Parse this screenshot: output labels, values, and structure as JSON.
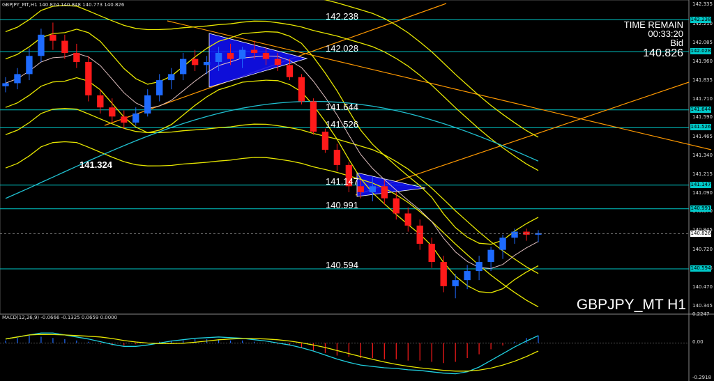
{
  "header": {
    "text": "GBPJPY_MT,H1  140.824 140.848 140.773 140.826"
  },
  "macd_header": {
    "text": "MACD(12,26,9) -0.0666 -0.1325 0.0659 0.0000"
  },
  "timer": {
    "label": "TIME REMAIN",
    "value": "00:33:20",
    "bid_label": "Bid",
    "bid_value": "140.826"
  },
  "symbol": "GBPJPY_MT H1",
  "levels": [
    {
      "value": "142.238",
      "y": 142.238
    },
    {
      "value": "142.028",
      "y": 142.028
    },
    {
      "value": "141.644",
      "y": 141.644
    },
    {
      "value": "141.526",
      "y": 141.526
    },
    {
      "value": "141.147",
      "y": 141.147
    },
    {
      "value": "140.991",
      "y": 140.991
    },
    {
      "value": "140.594",
      "y": 140.594
    }
  ],
  "extra_label": "141.324",
  "price_axis": [
    "142.335",
    "142.210",
    "142.085",
    "141.960",
    "141.835",
    "141.710",
    "141.590",
    "141.465",
    "141.340",
    "141.215",
    "141.090",
    "140.970",
    "140.845",
    "140.720",
    "140.595",
    "140.470",
    "140.345"
  ],
  "macd_axis": [
    "0.2247",
    "0.00",
    "-0.2918"
  ],
  "current_price": "140.826",
  "colors": {
    "bull": "#1e6bff",
    "bear": "#ff1a1a",
    "level_line": "#00c8c8",
    "band": "#e6e600",
    "trend": "#ff9900",
    "ma": "#20c0d0",
    "triangle": "#1010ff"
  },
  "chart_data": {
    "type": "candlestick",
    "symbol": "GBPJPY_MT",
    "timeframe": "H1",
    "ylim": [
      140.3,
      142.36
    ],
    "candles_ohlc": [
      [
        141.8,
        141.86,
        141.76,
        141.82
      ],
      [
        141.82,
        141.92,
        141.78,
        141.88
      ],
      [
        141.88,
        142.05,
        141.84,
        142.0
      ],
      [
        142.0,
        142.18,
        141.96,
        142.14
      ],
      [
        142.14,
        142.22,
        142.04,
        142.1
      ],
      [
        142.1,
        142.14,
        141.98,
        142.02
      ],
      [
        142.02,
        142.08,
        141.92,
        141.96
      ],
      [
        141.96,
        142.0,
        141.7,
        141.74
      ],
      [
        141.74,
        141.78,
        141.62,
        141.66
      ],
      [
        141.66,
        141.72,
        141.56,
        141.6
      ],
      [
        141.6,
        141.64,
        141.52,
        141.56
      ],
      [
        141.56,
        141.66,
        141.54,
        141.62
      ],
      [
        141.62,
        141.78,
        141.6,
        141.74
      ],
      [
        141.74,
        141.88,
        141.7,
        141.84
      ],
      [
        141.84,
        141.92,
        141.78,
        141.88
      ],
      [
        141.88,
        142.02,
        141.84,
        141.98
      ],
      [
        141.98,
        142.04,
        141.9,
        141.94
      ],
      [
        141.94,
        142.0,
        141.88,
        141.96
      ],
      [
        141.96,
        142.06,
        141.9,
        142.02
      ],
      [
        142.02,
        142.08,
        141.94,
        141.98
      ],
      [
        141.98,
        142.06,
        141.92,
        142.04
      ],
      [
        142.04,
        142.1,
        141.98,
        142.02
      ],
      [
        142.02,
        142.06,
        141.94,
        141.98
      ],
      [
        141.98,
        142.02,
        141.9,
        141.94
      ],
      [
        141.94,
        141.98,
        141.84,
        141.86
      ],
      [
        141.86,
        141.88,
        141.68,
        141.7
      ],
      [
        141.7,
        141.72,
        141.48,
        141.5
      ],
      [
        141.5,
        141.52,
        141.36,
        141.38
      ],
      [
        141.38,
        141.42,
        141.24,
        141.28
      ],
      [
        141.28,
        141.3,
        141.1,
        141.14
      ],
      [
        141.14,
        141.18,
        141.06,
        141.1
      ],
      [
        141.1,
        141.2,
        141.04,
        141.14
      ],
      [
        141.14,
        141.18,
        141.02,
        141.06
      ],
      [
        141.06,
        141.1,
        140.92,
        140.96
      ],
      [
        140.96,
        141.0,
        140.84,
        140.88
      ],
      [
        140.88,
        140.92,
        140.72,
        140.76
      ],
      [
        140.76,
        140.8,
        140.6,
        140.64
      ],
      [
        140.64,
        140.68,
        140.44,
        140.48
      ],
      [
        140.48,
        140.56,
        140.4,
        140.52
      ],
      [
        140.52,
        140.62,
        140.46,
        140.58
      ],
      [
        140.58,
        140.68,
        140.52,
        140.64
      ],
      [
        140.64,
        140.74,
        140.58,
        140.72
      ],
      [
        140.72,
        140.82,
        140.66,
        140.8
      ],
      [
        140.8,
        140.86,
        140.76,
        140.84
      ],
      [
        140.84,
        140.86,
        140.78,
        140.82
      ],
      [
        140.82,
        140.85,
        140.77,
        140.83
      ]
    ],
    "macd_hist": [
      0.02,
      0.04,
      0.06,
      0.05,
      0.04,
      0.03,
      0.02,
      0.01,
      -0.01,
      -0.02,
      -0.02,
      -0.01,
      0.0,
      0.01,
      0.02,
      0.02,
      0.03,
      0.03,
      0.03,
      0.02,
      0.02,
      0.01,
      0.0,
      -0.01,
      -0.02,
      -0.04,
      -0.06,
      -0.08,
      -0.1,
      -0.11,
      -0.12,
      -0.12,
      -0.13,
      -0.13,
      -0.14,
      -0.14,
      -0.15,
      -0.16,
      -0.15,
      -0.12,
      -0.09,
      -0.05,
      -0.02,
      0.01,
      0.04,
      0.06
    ],
    "macd_ylim": [
      -0.2918,
      0.2247
    ]
  }
}
